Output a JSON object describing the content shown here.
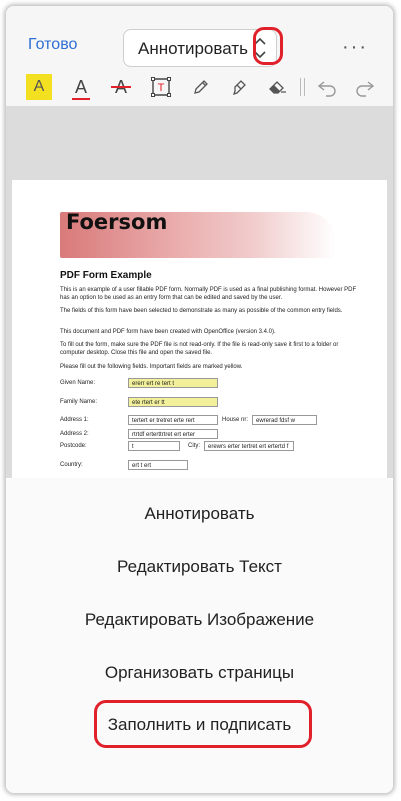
{
  "topbar": {
    "done_label": "Готово",
    "mode_label": "Аннотировать",
    "more_label": "···"
  },
  "toolbar": {
    "highlight_glyph": "A",
    "underline_glyph": "A",
    "strike_glyph": "A",
    "textbox_glyph": "T"
  },
  "document": {
    "logo": "Foersom",
    "title": "PDF Form Example",
    "paragraphs": [
      "This is an example of a user fillable PDF form. Normally PDF is used as a final publishing format. However PDF has an option to be used as an entry form that can be edited and saved by the user.",
      "The fields of this form have been selected to demonstrate as many as possible of the common entry fields.",
      "This document and PDF form have been created with OpenOffice (version 3.4.0).",
      "To fill out the form, make sure the PDF file is not read-only. If the file is read-only save it first to a folder or computer desktop. Close this file and open the saved file.",
      "Please fill out the following fields. Important fields are marked yellow."
    ],
    "labels": {
      "given_name": "Given Name:",
      "family_name": "Family Name:",
      "address1": "Address 1:",
      "address2": "Address 2:",
      "postcode": "Postcode:",
      "house_nr": "House nr:",
      "city": "City:",
      "country": "Country:"
    },
    "values": {
      "given_name": "ererr ert re tert t",
      "family_name": "ete rtert er tt",
      "address1": "tertert er tretret  erte rert",
      "address2": "rtrtdf erterttrtret ert erter",
      "postcode": "t",
      "house_nr": "ewrerad fdsf w",
      "city": "erewrs erter tertret ert ertertd f",
      "country": "ert t ert"
    }
  },
  "menu": {
    "items": [
      "Аннотировать",
      "Редактировать Текст",
      "Редактировать Изображение",
      "Организовать страницы",
      "Заполнить и подписать"
    ]
  },
  "colors": {
    "accent": "#2f6fd4",
    "highlight_annotation": "#e0202a",
    "required_field": "#f2f09a"
  }
}
